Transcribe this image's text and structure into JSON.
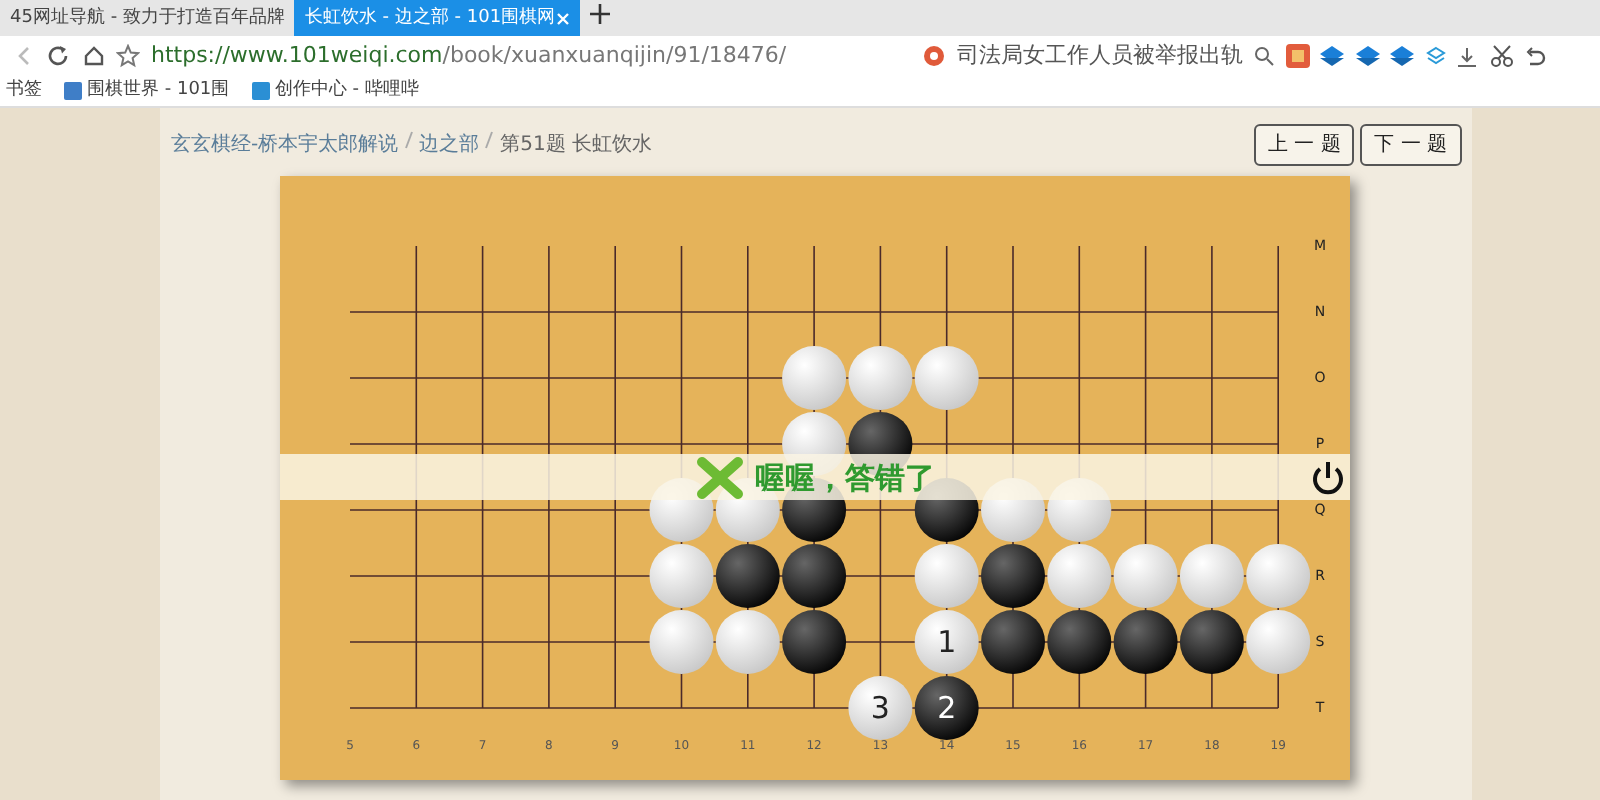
{
  "browser": {
    "tabs": [
      {
        "title": "45网址导航 - 致力于打造百年品牌",
        "selected": false
      },
      {
        "title": "长虹饮水 - 边之部 - 101围棋网",
        "selected": true
      }
    ],
    "url_host": "https://www.101weiqi.com",
    "url_path": "/book/xuanxuanqijin/91/18476/",
    "search_suggestion": "司法局女工作人员被举报出轨",
    "bookmarks": [
      {
        "title": "书签"
      },
      {
        "title": "围棋世界 - 101围"
      },
      {
        "title": "创作中心 - 哔哩哔"
      }
    ]
  },
  "breadcrumb": [
    {
      "label": "玄玄棋经-桥本宇太郎解说"
    },
    {
      "label": "边之部"
    },
    {
      "label": "第51题 长虹饮水"
    }
  ],
  "buttons": [
    "上 一 题",
    "下 一 题"
  ],
  "board": {
    "column_labels": [
      "5",
      "6",
      "7",
      "8",
      "9",
      "10",
      "11",
      "12",
      "13",
      "14",
      "15",
      "16",
      "17",
      "18",
      "19"
    ],
    "rows": [
      {
        "label": "M",
        "points": [
          {
            "kind": "empty"
          },
          {
            "kind": "empty"
          },
          {
            "kind": "empty"
          },
          {
            "kind": "empty"
          },
          {
            "kind": "empty"
          },
          {
            "kind": "empty"
          },
          {
            "kind": "empty"
          },
          {
            "kind": "empty"
          },
          {
            "kind": "empty"
          },
          {
            "kind": "empty"
          },
          {
            "kind": "empty"
          },
          {
            "kind": "empty"
          },
          {
            "kind": "empty"
          },
          {
            "kind": "empty"
          },
          {
            "kind": "empty"
          }
        ]
      },
      {
        "label": "N",
        "points": [
          {
            "kind": "empty"
          },
          {
            "kind": "empty"
          },
          {
            "kind": "empty"
          },
          {
            "kind": "empty"
          },
          {
            "kind": "empty"
          },
          {
            "kind": "empty"
          },
          {
            "kind": "empty"
          },
          {
            "kind": "empty"
          },
          {
            "kind": "empty"
          },
          {
            "kind": "empty"
          },
          {
            "kind": "empty"
          },
          {
            "kind": "empty"
          },
          {
            "kind": "empty"
          },
          {
            "kind": "empty"
          },
          {
            "kind": "empty"
          }
        ]
      },
      {
        "label": "O",
        "points": [
          {
            "kind": "empty"
          },
          {
            "kind": "empty"
          },
          {
            "kind": "empty"
          },
          {
            "kind": "empty"
          },
          {
            "kind": "empty"
          },
          {
            "kind": "empty"
          },
          {
            "kind": "empty"
          },
          {
            "kind": "white"
          },
          {
            "kind": "white"
          },
          {
            "kind": "white"
          },
          {
            "kind": "empty"
          },
          {
            "kind": "empty"
          },
          {
            "kind": "empty"
          },
          {
            "kind": "empty"
          },
          {
            "kind": "empty"
          }
        ]
      },
      {
        "label": "P",
        "points": [
          {
            "kind": "empty"
          },
          {
            "kind": "empty"
          },
          {
            "kind": "empty"
          },
          {
            "kind": "empty"
          },
          {
            "kind": "empty"
          },
          {
            "kind": "empty"
          },
          {
            "kind": "empty"
          },
          {
            "kind": "white"
          },
          {
            "kind": "black"
          },
          {
            "kind": "empty"
          },
          {
            "kind": "empty"
          },
          {
            "kind": "empty"
          },
          {
            "kind": "empty"
          },
          {
            "kind": "empty"
          },
          {
            "kind": "empty"
          }
        ]
      },
      {
        "label": "Q",
        "points": [
          {
            "kind": "empty"
          },
          {
            "kind": "empty"
          },
          {
            "kind": "empty"
          },
          {
            "kind": "empty"
          },
          {
            "kind": "empty"
          },
          {
            "kind": "white"
          },
          {
            "kind": "white"
          },
          {
            "kind": "black"
          },
          {
            "kind": "empty"
          },
          {
            "kind": "black"
          },
          {
            "kind": "white"
          },
          {
            "kind": "white"
          },
          {
            "kind": "empty"
          },
          {
            "kind": "empty"
          },
          {
            "kind": "empty"
          }
        ]
      },
      {
        "label": "R",
        "points": [
          {
            "kind": "empty"
          },
          {
            "kind": "empty"
          },
          {
            "kind": "empty"
          },
          {
            "kind": "empty"
          },
          {
            "kind": "empty"
          },
          {
            "kind": "white"
          },
          {
            "kind": "black"
          },
          {
            "kind": "black"
          },
          {
            "kind": "empty"
          },
          {
            "kind": "white"
          },
          {
            "kind": "black"
          },
          {
            "kind": "white"
          },
          {
            "kind": "white"
          },
          {
            "kind": "white"
          },
          {
            "kind": "white"
          }
        ]
      },
      {
        "label": "S",
        "points": [
          {
            "kind": "empty"
          },
          {
            "kind": "empty"
          },
          {
            "kind": "empty"
          },
          {
            "kind": "empty"
          },
          {
            "kind": "empty"
          },
          {
            "kind": "white"
          },
          {
            "kind": "white"
          },
          {
            "kind": "black"
          },
          {
            "kind": "empty"
          },
          {
            "kind": "white",
            "number": "1"
          },
          {
            "kind": "black"
          },
          {
            "kind": "black"
          },
          {
            "kind": "black"
          },
          {
            "kind": "black"
          },
          {
            "kind": "white"
          }
        ]
      },
      {
        "label": "T",
        "points": [
          {
            "kind": "empty"
          },
          {
            "kind": "empty"
          },
          {
            "kind": "empty"
          },
          {
            "kind": "empty"
          },
          {
            "kind": "empty"
          },
          {
            "kind": "empty"
          },
          {
            "kind": "empty"
          },
          {
            "kind": "empty"
          },
          {
            "kind": "white",
            "number": "3"
          },
          {
            "kind": "black",
            "number": "2"
          },
          {
            "kind": "empty"
          },
          {
            "kind": "empty"
          },
          {
            "kind": "empty"
          },
          {
            "kind": "empty"
          },
          {
            "kind": "empty"
          }
        ]
      }
    ],
    "message": "喔喔，答错了"
  }
}
